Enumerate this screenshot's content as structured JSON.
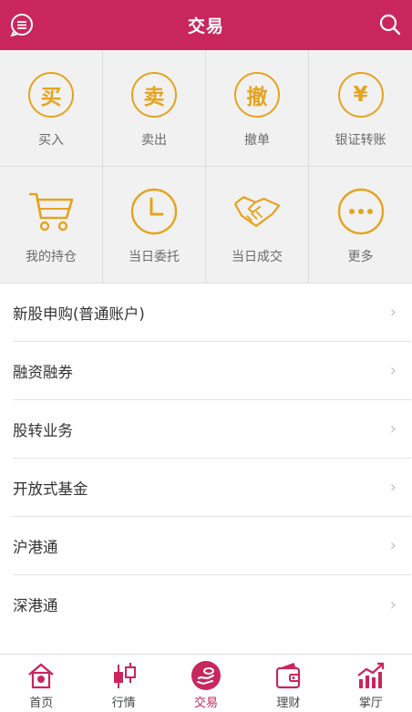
{
  "header": {
    "title": "交易",
    "menu_icon": "chat-menu-icon",
    "search_icon": "search-icon"
  },
  "grid": [
    {
      "label": "买入",
      "glyph": "买",
      "icon": "buy-icon"
    },
    {
      "label": "卖出",
      "glyph": "卖",
      "icon": "sell-icon"
    },
    {
      "label": "撤单",
      "glyph": "撤",
      "icon": "cancel-order-icon"
    },
    {
      "label": "银证转账",
      "glyph": "¥",
      "icon": "transfer-icon"
    },
    {
      "label": "我的持仓",
      "icon": "cart-icon"
    },
    {
      "label": "当日委托",
      "icon": "clock-icon"
    },
    {
      "label": "当日成交",
      "icon": "handshake-icon"
    },
    {
      "label": "更多",
      "icon": "more-icon"
    }
  ],
  "list": [
    {
      "label": "新股申购(普通账户)"
    },
    {
      "label": "融资融券"
    },
    {
      "label": "股转业务"
    },
    {
      "label": "开放式基金"
    },
    {
      "label": "沪港通"
    },
    {
      "label": "深港通"
    }
  ],
  "tabs": [
    {
      "label": "首页",
      "icon": "home-icon"
    },
    {
      "label": "行情",
      "icon": "candlestick-icon"
    },
    {
      "label": "交易",
      "icon": "trade-icon",
      "active": true
    },
    {
      "label": "理财",
      "icon": "wallet-icon"
    },
    {
      "label": "掌厅",
      "icon": "chart-up-icon"
    }
  ],
  "colors": {
    "brand": "#c8265c",
    "accent": "#e5a31f",
    "grid_bg": "#f1f1f1"
  }
}
